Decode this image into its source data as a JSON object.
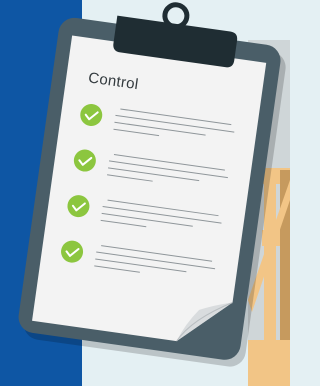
{
  "clipboard": {
    "title": "Control",
    "checklist_count": 4
  },
  "icons": {
    "check": "check-icon",
    "clip_ring": "clip-ring-icon"
  },
  "colors": {
    "blue_stripe": "#0e56a4",
    "background": "#e4f0f3",
    "board": "#4a5e68",
    "clip": "#1f2d33",
    "paper": "#f3f3f3",
    "paper_fold": "#d9dcde",
    "check_green": "#8cc63f",
    "text_lines": "#8f969a",
    "wood": "#f2c586",
    "wood_shadow": "#c69a5e",
    "wall_gray": "#cfd6d8"
  }
}
